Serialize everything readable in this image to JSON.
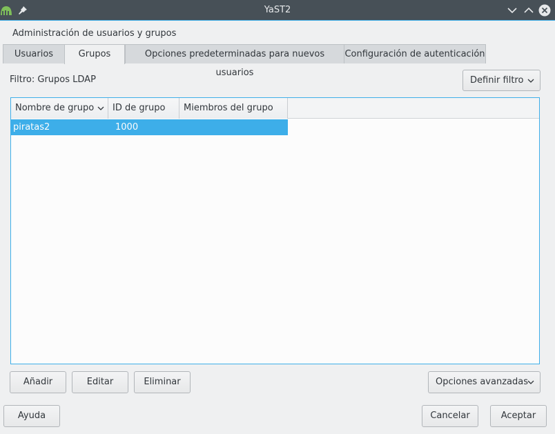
{
  "window": {
    "title": "YaST2"
  },
  "heading": "Administración de usuarios y grupos",
  "tabs": [
    {
      "label": "Usuarios",
      "active": false
    },
    {
      "label": "Grupos",
      "active": true
    },
    {
      "label": "Opciones predeterminadas para nuevos usuarios",
      "active": false
    },
    {
      "label": "Configuración de autenticación",
      "active": false
    }
  ],
  "filter": {
    "label": "Filtro: Grupos LDAP",
    "button": "Definir filtro"
  },
  "table": {
    "columns": [
      "Nombre de grupo",
      "ID de grupo",
      "Miembros del grupo"
    ],
    "rows": [
      {
        "name": "piratas2",
        "gid": "1000",
        "members": ""
      }
    ]
  },
  "actions": {
    "add": "Añadir",
    "edit": "Editar",
    "delete": "Eliminar",
    "advanced": "Opciones avanzadas"
  },
  "footer": {
    "help": "Ayuda",
    "cancel": "Cancelar",
    "accept": "Aceptar"
  },
  "colors": {
    "accent": "#3daee9",
    "titlebar": "#475057",
    "background": "#eff0f1"
  }
}
